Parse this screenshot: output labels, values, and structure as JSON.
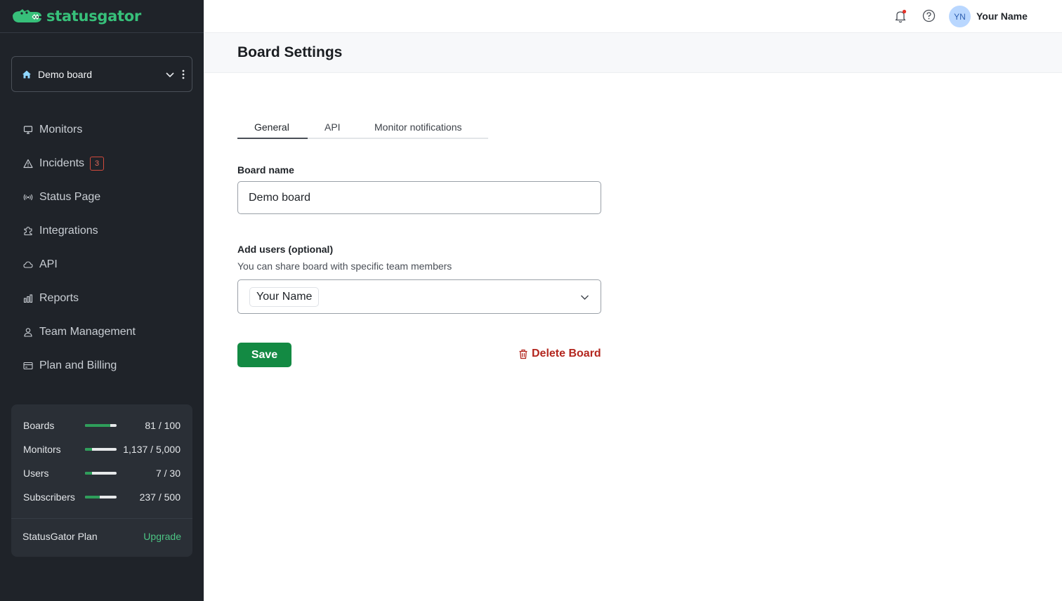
{
  "brand": {
    "name": "statusgator",
    "color": "#37c07a"
  },
  "sidebar": {
    "board_selector": {
      "label": "Demo board"
    },
    "nav": [
      {
        "label": "Monitors",
        "icon": "monitor-icon"
      },
      {
        "label": "Incidents",
        "icon": "warning-icon",
        "badge": "3"
      },
      {
        "label": "Status Page",
        "icon": "broadcast-icon"
      },
      {
        "label": "Integrations",
        "icon": "puzzle-icon"
      },
      {
        "label": "API",
        "icon": "cloud-icon"
      },
      {
        "label": "Reports",
        "icon": "bar-chart-icon"
      },
      {
        "label": "Team Management",
        "icon": "user-icon"
      },
      {
        "label": "Plan and Billing",
        "icon": "credit-card-icon"
      }
    ],
    "usage": [
      {
        "label": "Boards",
        "value": "81 / 100",
        "fraction": 0.81
      },
      {
        "label": "Monitors",
        "value": "1,137 / 5,000",
        "fraction": 0.23
      },
      {
        "label": "Users",
        "value": "7 / 30",
        "fraction": 0.23
      },
      {
        "label": "Subscribers",
        "value": "237 / 500",
        "fraction": 0.47
      }
    ],
    "plan": {
      "label": "StatusGator Plan",
      "upgrade": "Upgrade"
    }
  },
  "topbar": {
    "avatar_initials": "YN",
    "user_name": "Your Name"
  },
  "page": {
    "title": "Board Settings",
    "tabs": [
      {
        "label": "General",
        "active": true
      },
      {
        "label": "API",
        "active": false
      },
      {
        "label": "Monitor notifications",
        "active": false
      }
    ],
    "form": {
      "board_name_label": "Board name",
      "board_name_value": "Demo board",
      "add_users_label": "Add users (optional)",
      "add_users_hint": "You can share board with specific team members",
      "selected_user": "Your Name",
      "save_label": "Save",
      "delete_label": "Delete Board"
    }
  },
  "colors": {
    "sidebar_bg": "#1f2329",
    "save_button": "#138a43",
    "delete_text": "#b3261e",
    "badge": "#d24a3c"
  }
}
